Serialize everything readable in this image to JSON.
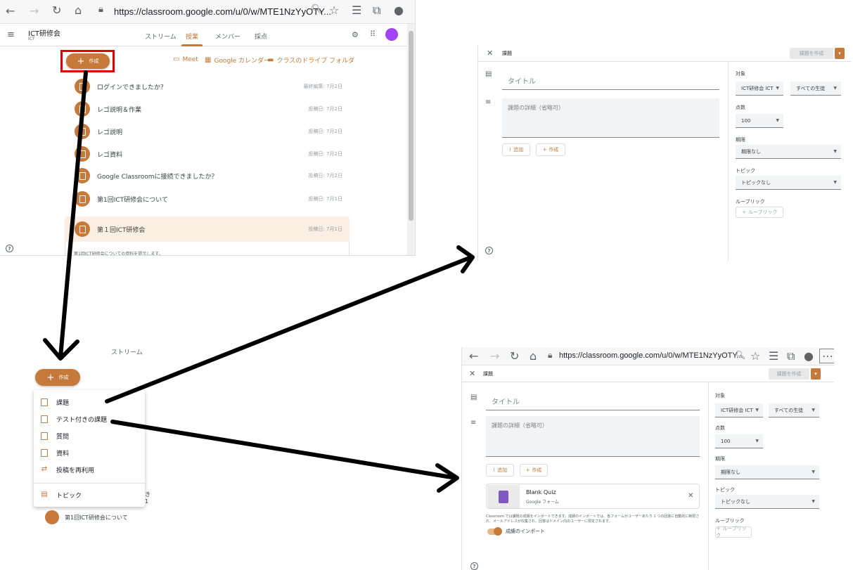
{
  "browser": {
    "url": "https://classroom.google.com/u/0/w/MTE1NzYyOTY..."
  },
  "classroom": {
    "class_name": "ICT研修会",
    "class_section": "ICT",
    "tabs": [
      "ストリーム",
      "授業",
      "メンバー",
      "採点"
    ],
    "active_tab": "授業",
    "create_label": "作成",
    "quick_links": {
      "meet": "Meet",
      "calendar": "Google カレンダー",
      "drive": "クラスのドライブ フォルダ"
    },
    "items": [
      {
        "title": "ログインできましたか？",
        "date": "最終編集: 7月2日"
      },
      {
        "title": "レゴ説明＆作業",
        "date": "投稿日: 7月2日"
      },
      {
        "title": "レゴ説明",
        "date": "投稿日: 7月2日"
      },
      {
        "title": "レゴ資料",
        "date": "投稿日: 7月2日"
      },
      {
        "title": "Google Classroomに接続できましたか？",
        "date": "投稿日: 7月2日"
      },
      {
        "title": "第1回ICT研修会について",
        "date": "投稿日: 7月1日"
      },
      {
        "title": "第１回ICT研修会",
        "date": "投稿日: 7月1日"
      }
    ],
    "footer_text": "第1回ICT研修会についての資料を提示します。"
  },
  "assignment": {
    "header": "課題",
    "assign_button": "課題を作成",
    "title_placeholder": "タイトル",
    "description_placeholder": "課題の詳細（省略可）",
    "add_button": "追加",
    "create_button": "作成",
    "target_label": "対象",
    "target_class": "ICT研修会 ICT",
    "target_students": "すべての生徒",
    "points_label": "点数",
    "points_value": "100",
    "due_label": "期限",
    "due_value": "期限なし",
    "topic_label": "トピック",
    "topic_value": "トピックなし",
    "rubric_label": "ルーブリック",
    "rubric_button": "＋ ルーブリック"
  },
  "create_menu": {
    "stream_tab": "ストリーム",
    "create_label": "作成",
    "items": [
      "課題",
      "テスト付きの課題",
      "質問",
      "資料",
      "投稿を再利用"
    ],
    "topic_item": "トピック",
    "background_item": "第1回ICT研修会について",
    "background_partial": "き1"
  },
  "quiz": {
    "attachment_title": "Blank Quiz",
    "attachment_type": "Google フォーム",
    "import_note": "Classroom では課題の成績をインポートできます。成績のインポートでは、各フォームがユーザーあたり 1 つの回答に自動的に制限され、メールアドレスが収集され、回答はドメイン内のユーザーに限定されます。",
    "import_label": "成績のインポート"
  },
  "colors": {
    "accent": "#c5793a",
    "highlight": "#e00000",
    "arrow": "#000000"
  }
}
